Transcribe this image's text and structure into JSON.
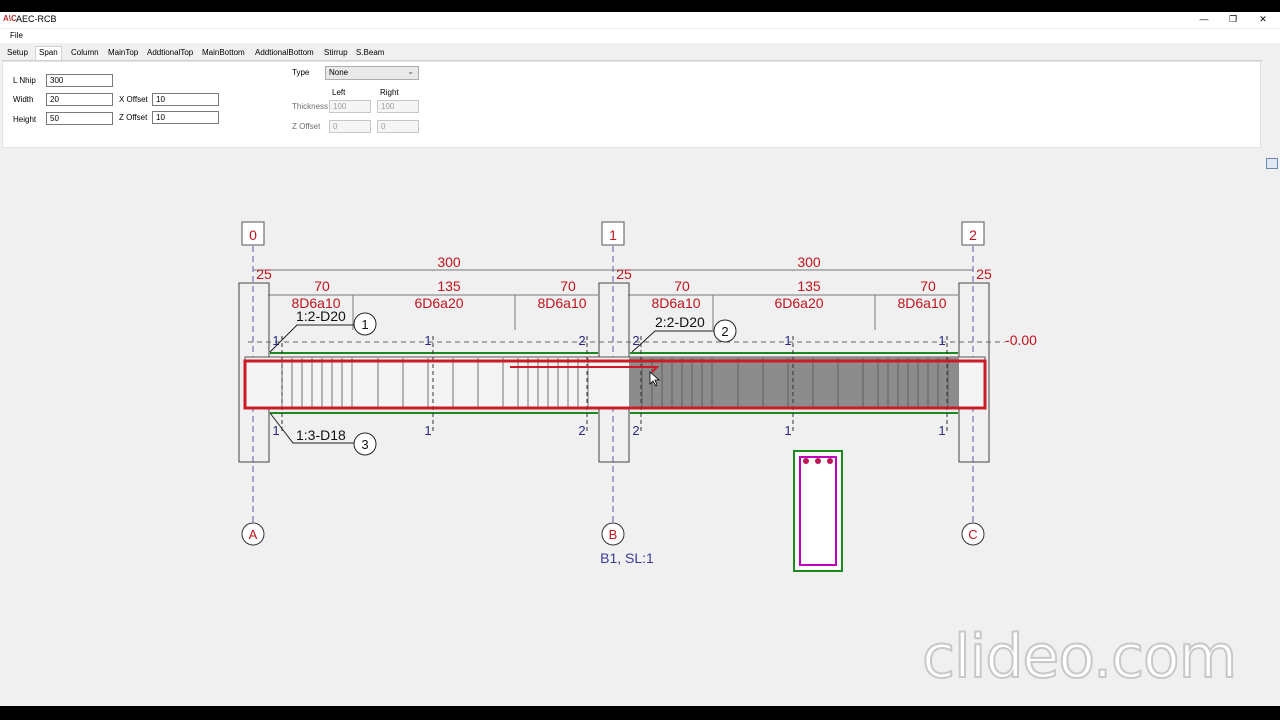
{
  "window": {
    "icon_text": "A\\C",
    "title": "AEC-RCB",
    "minimize": "—",
    "restore": "❐",
    "close": "✕"
  },
  "menu": {
    "file": "File"
  },
  "tabs": [
    "Setup",
    "Span",
    "Column",
    "MainTop",
    "AddtionalTop",
    "MainBottom",
    "AddtionalBottom",
    "Stirrup",
    "S.Beam"
  ],
  "active_tab": "Span",
  "form": {
    "lnhip_label": "L Nhip",
    "lnhip_value": "300",
    "width_label": "Width",
    "width_value": "20",
    "height_label": "Height",
    "height_value": "50",
    "xoffset_label": "X Offset",
    "xoffset_value": "10",
    "zoffset_label": "Z Offset",
    "zoffset_value": "10",
    "type_label": "Type",
    "type_value": "None",
    "left_label": "Left",
    "right_label": "Right",
    "thickness_label": "Thickness",
    "thickness_left": "100",
    "thickness_right": "100",
    "zoffset2_label": "Z Offset",
    "zoffset2_left": "0",
    "zoffset2_right": "0"
  },
  "drawing": {
    "grid_numbers": [
      "0",
      "1",
      "2"
    ],
    "grid_letters": [
      "A",
      "B",
      "C"
    ],
    "span_lengths": [
      "300",
      "300"
    ],
    "support_widths": [
      "25",
      "25",
      "25"
    ],
    "stirrup_lengths": [
      "70",
      "135",
      "70",
      "70",
      "135",
      "70"
    ],
    "stirrup_specs": [
      "8D6a10",
      "6D6a20",
      "8D6a10",
      "8D6a10",
      "6D6a20",
      "8D6a10"
    ],
    "top_markers_left": [
      "1",
      "1",
      "2"
    ],
    "top_markers_right": [
      "2",
      "1",
      "1"
    ],
    "bottom_markers_left": [
      "1",
      "1",
      "2"
    ],
    "bottom_markers_right": [
      "2",
      "1",
      "1"
    ],
    "rebar_tags": [
      "1:2-D20",
      "2:2-D20",
      "1:3-D18"
    ],
    "rebar_tag_numbers": [
      "1",
      "2",
      "3"
    ],
    "level_label": "-0.00",
    "beam_label": "B1, SL:1",
    "colors": {
      "dim_red": "#c0141c",
      "marker_blue": "#2a2a8a",
      "highlight": "#cc1b26",
      "rebar_green": "#1e8a1e",
      "section_magenta": "#c000c0"
    }
  },
  "watermark": "clideo.com"
}
